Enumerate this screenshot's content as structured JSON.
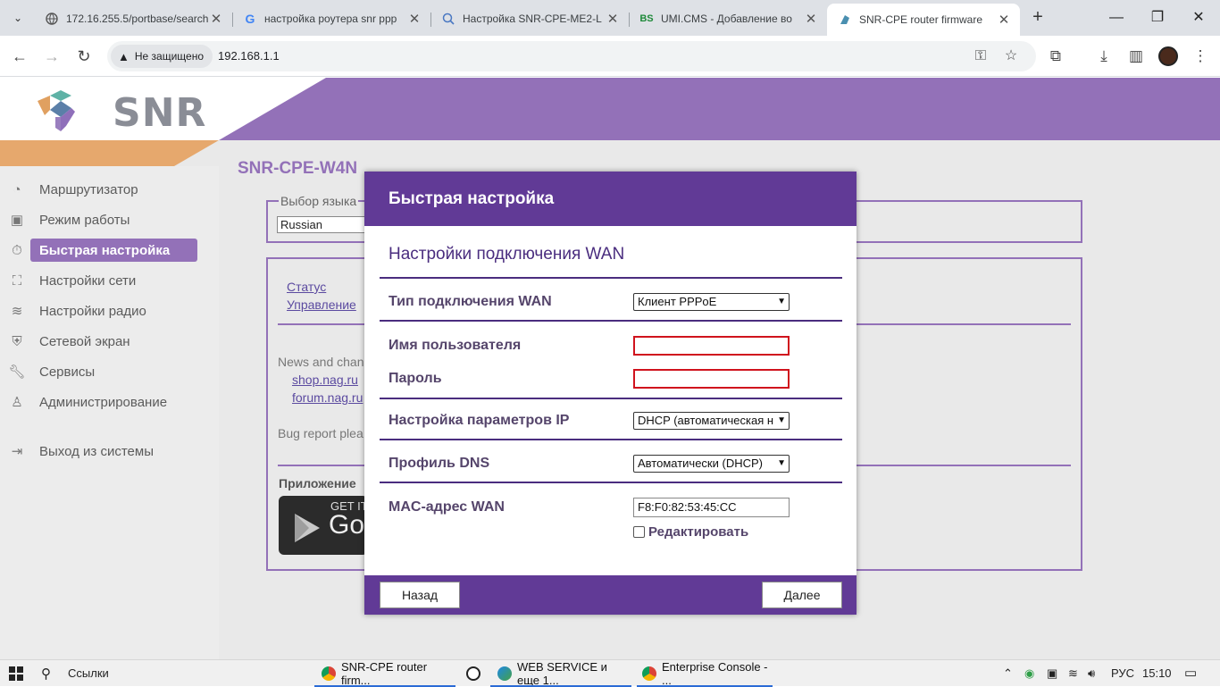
{
  "browser": {
    "tabs": [
      {
        "title": "172.16.255.5/portbase/search",
        "favicon": "globe-icon"
      },
      {
        "title": "настройка роутера snr ppp",
        "favicon": "google-icon"
      },
      {
        "title": "Настройка SNR-CPE-ME2-L",
        "favicon": "search-docs-icon"
      },
      {
        "title": "UMI.CMS - Добавление во",
        "favicon": "bs-icon",
        "favicon_text": "BS"
      },
      {
        "title": "SNR-CPE router firmware",
        "favicon": "snr-icon",
        "active": true
      }
    ],
    "security_label": "Не защищено",
    "url": "192.168.1.1"
  },
  "page": {
    "logo_text": "SNR",
    "router_title": "SNR-CPE-W4N",
    "language_legend": "Выбор языка",
    "language_value": "Russian",
    "status_link": "Статус",
    "management_link": "Управление",
    "news_text": "News and chan",
    "shop_link": "shop.nag.ru",
    "forum_link": "forum.nag.ru",
    "bug_text": "Bug report plea",
    "app_label": "Приложение",
    "gplay_small": "GET IT",
    "gplay_big": "Go"
  },
  "sidebar": {
    "items": [
      {
        "label": "Маршрутизатор",
        "icon": "dashboard-icon"
      },
      {
        "label": "Режим работы",
        "icon": "mode-icon"
      },
      {
        "label": "Быстрая настройка",
        "icon": "timer-icon",
        "active": true
      },
      {
        "label": "Настройки сети",
        "icon": "network-icon"
      },
      {
        "label": "Настройки радио",
        "icon": "wifi-icon"
      },
      {
        "label": "Сетевой экран",
        "icon": "shield-icon"
      },
      {
        "label": "Сервисы",
        "icon": "wrench-icon"
      },
      {
        "label": "Администрирование",
        "icon": "admin-icon"
      },
      {
        "label": "Выход из системы",
        "icon": "logout-icon"
      }
    ]
  },
  "modal": {
    "title": "Быстрая настройка",
    "section": "Настройки подключения WAN",
    "wan_type_label": "Тип подключения WAN",
    "wan_type_value": "Клиент PPPoE",
    "username_label": "Имя пользователя",
    "username_value": "",
    "password_label": "Пароль",
    "password_value": "",
    "ip_label": "Настройка параметров IP",
    "ip_value": "DHCP (автоматическая н",
    "dns_label": "Профиль DNS",
    "dns_value": "Автоматически (DHCP)",
    "mac_label": "MAC-адрес WAN",
    "mac_value": "F8:F0:82:53:45:CC",
    "edit_label": "Редактировать",
    "edit_checked": false,
    "back_button": "Назад",
    "next_button": "Далее"
  },
  "taskbar": {
    "search_label": "Ссылки",
    "apps": [
      {
        "label": "SNR-CPE router firm...",
        "icon": "chrome-icon",
        "active": true
      },
      {
        "label": "",
        "icon": "whatsapp-icon"
      },
      {
        "label": "WEB SERVICE и еще 1...",
        "icon": "edge-icon",
        "active": true
      },
      {
        "label": "Enterprise Console - ...",
        "icon": "chrome-icon",
        "active": true
      }
    ],
    "language": "РУС",
    "time": "15:10"
  },
  "colors": {
    "accent_purple": "#9371b8",
    "modal_purple": "#613a96",
    "orange": "#e6a86d",
    "error_red": "#d0131d"
  }
}
